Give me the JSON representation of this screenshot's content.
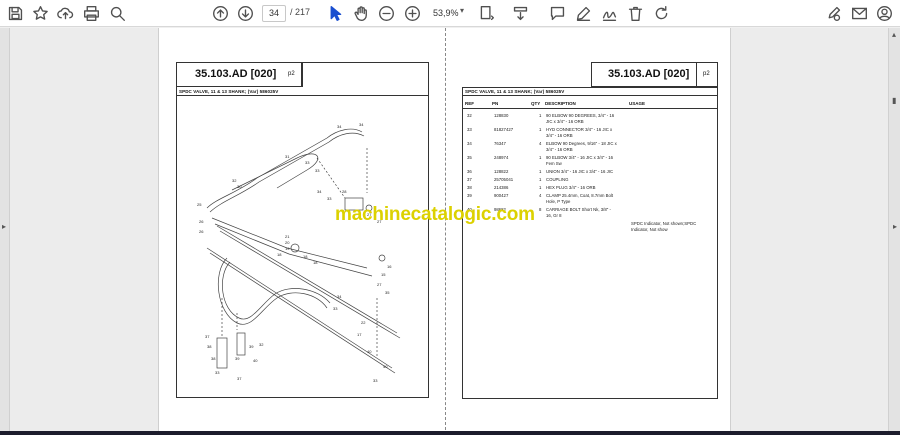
{
  "toolbar": {
    "page_current": "34",
    "page_total": "/ 217",
    "zoom": "53,9%",
    "icons": [
      "save-icon",
      "bookmark-star-icon",
      "upload-cloud-icon",
      "print-icon",
      "zoom-search-icon",
      "page-up-icon",
      "page-down-icon",
      "select-cursor-icon",
      "hand-pan-icon",
      "zoom-out-icon",
      "zoom-in-icon",
      "fit-page-icon",
      "scroll-mode-icon",
      "comment-icon",
      "highlight-pen-icon",
      "sign-draw-icon",
      "delete-trash-icon",
      "rotate-icon",
      "edit-sign-icon",
      "email-icon",
      "account-icon"
    ]
  },
  "left_page": {
    "title": "35.103.AD [020]",
    "page_num": "p2",
    "subtitle": "SPDC VALVE, 11 & 13 SHANK; (Var) 586025V",
    "callouts": [
      "34",
      "34",
      "31",
      "33",
      "33",
      "32",
      "30",
      "25",
      "34",
      "33",
      "28",
      "27",
      "27",
      "26",
      "26",
      "21",
      "20",
      "19",
      "18",
      "18",
      "18",
      "16",
      "15",
      "27",
      "35",
      "34",
      "33",
      "22",
      "17",
      "37",
      "38",
      "38",
      "39",
      "39",
      "32",
      "40",
      "33",
      "37",
      "40",
      "40",
      "33",
      "37"
    ]
  },
  "right_page": {
    "title": "35.103.AD [020]",
    "page_num": "p2",
    "subtitle": "SPDC VALVE, 11 & 13 SHANK; (Var) 586025V",
    "columns": {
      "ref": "REF",
      "pn": "PN",
      "qty": "QTY",
      "desc": "DESCRIPTION",
      "usage": "USAGE"
    },
    "rows": [
      {
        "ref": "32",
        "pn": "128830",
        "qty": "1",
        "desc1": "90 ELBOW 90 DEGREES, 3/4\" - 16",
        "desc2": "JIC x 3/4\" - 16 ORB"
      },
      {
        "ref": "33",
        "pn": "81827427",
        "qty": "1",
        "desc1": "HYD CONNECTOR 3/4\" - 16 JIC x",
        "desc2": "3/4\" - 16 ORB"
      },
      {
        "ref": "34",
        "pn": "76347",
        "qty": "4",
        "desc1": "ELBOW 90 Degrees, 9/16\" - 18 JIC x",
        "desc2": "3/4\" - 16 ORB"
      },
      {
        "ref": "35",
        "pn": "248974",
        "qty": "1",
        "desc1": "90 ELBOW 3/4\" - 16 JIC x 3/4\" - 16",
        "desc2": "Fem Sw"
      },
      {
        "ref": "36",
        "pn": "128822",
        "qty": "1",
        "desc1": "UNION 3/4\" - 16 JIC x 3/4\" - 16 JIC",
        "desc2": ""
      },
      {
        "ref": "37",
        "pn": "25705041",
        "qty": "1",
        "desc1": "COUPLING",
        "desc2": ""
      },
      {
        "ref": "38",
        "pn": "214386",
        "qty": "1",
        "desc1": "HEX PLUG 3/4\" - 16 ORB",
        "desc2": ""
      },
      {
        "ref": "39",
        "pn": "900427",
        "qty": "4",
        "desc1": "CLAMP 25.4mm, Coat, 8.7mm Bolt",
        "desc2": "Hole, P Type"
      },
      {
        "ref": "40",
        "pn": "98682",
        "qty": "8",
        "desc1": "CARRIAGE BOLT Short Nk, 3/8\" -",
        "desc2": "16, Gr 8"
      }
    ],
    "usage_text1": "SPDC Indicator, Not shown;SPDC",
    "usage_text2": "Indicator, Not show"
  },
  "watermark": "machinecatalogic.com"
}
